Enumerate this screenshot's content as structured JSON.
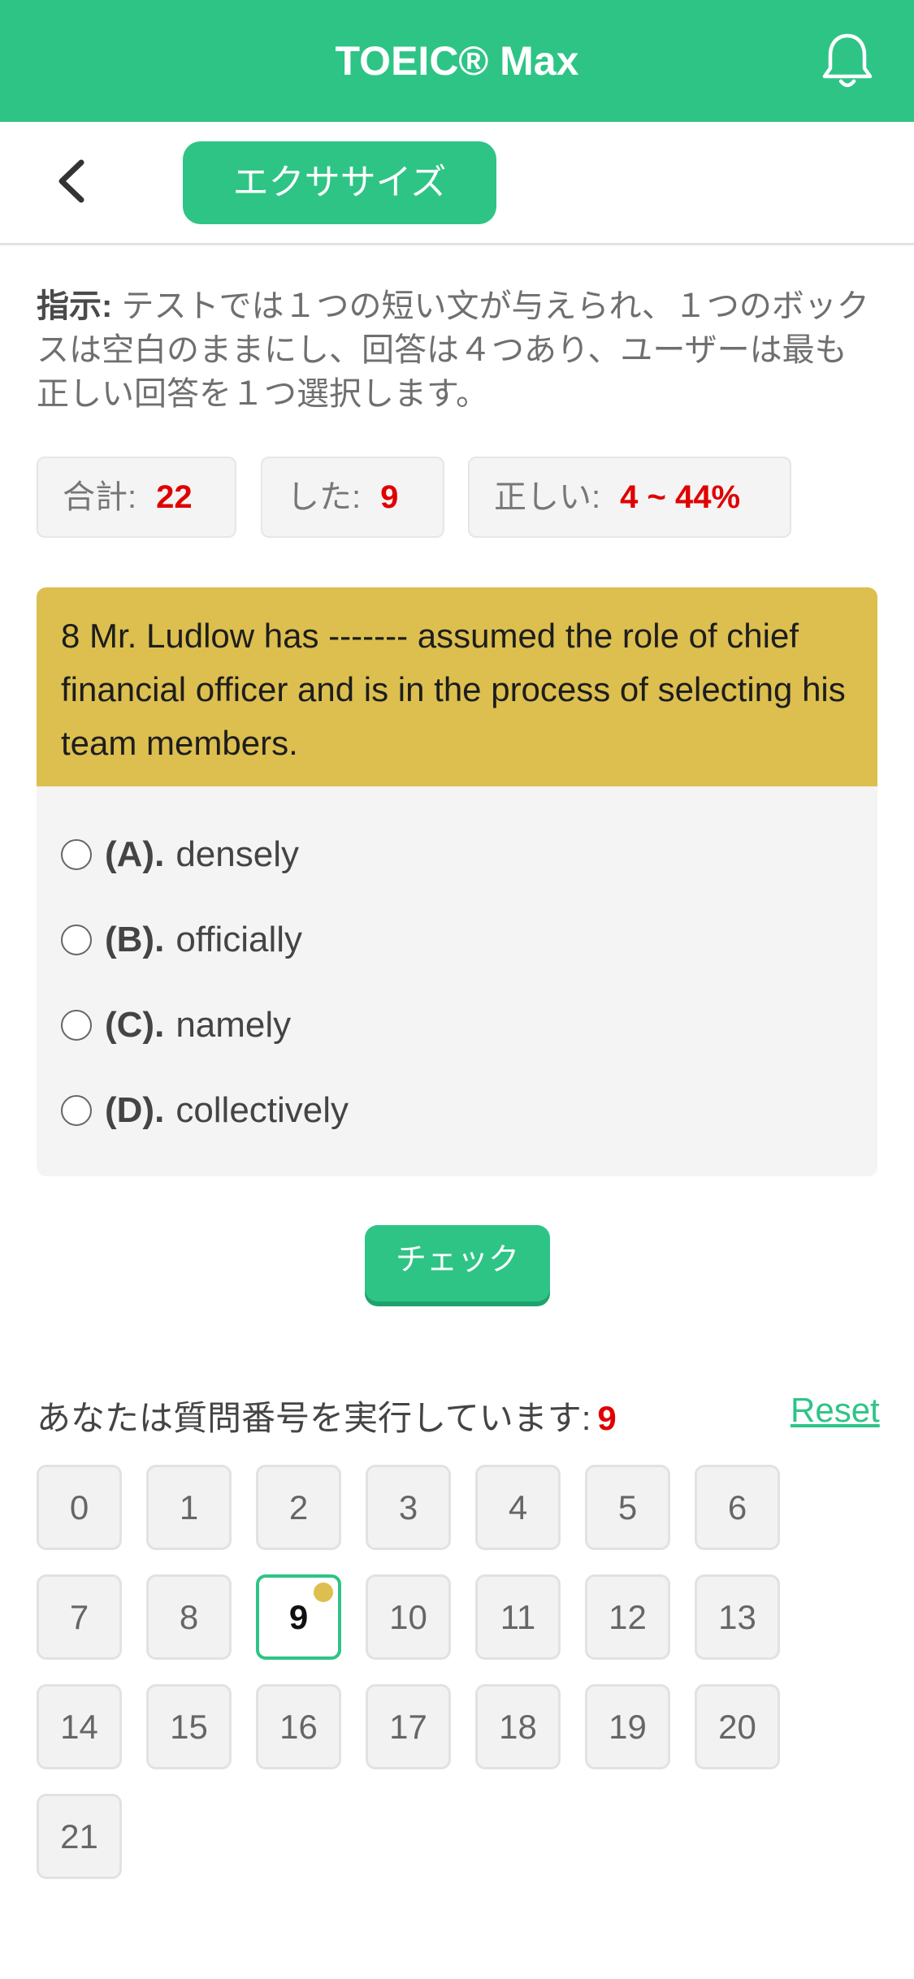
{
  "header": {
    "title": "TOEIC® Max",
    "bell_icon": "bell-icon"
  },
  "subnav": {
    "back_icon": "chevron-left-icon",
    "tab_label": "エクササイズ"
  },
  "instruction": {
    "label": "指示:",
    "text": " テストでは１つの短い文が与えられ、１つのボックスは空白のままにし、回答は４つあり、ユーザーは最も正しい回答を１つ選択します。"
  },
  "stats": {
    "total_label": "合計:",
    "total_value": "22",
    "done_label": "した:",
    "done_value": "9",
    "correct_label": "正しい:",
    "correct_value": "4 ~ 44%"
  },
  "question": {
    "text": "8 Mr. Ludlow has ------- assumed the role of chief financial officer and is in the process of selecting his team members.",
    "options": [
      {
        "letter": "(A).",
        "text": "densely"
      },
      {
        "letter": "(B).",
        "text": "officially"
      },
      {
        "letter": "(C).",
        "text": "namely"
      },
      {
        "letter": "(D).",
        "text": "collectively"
      }
    ]
  },
  "check_label": "チェック",
  "progress": {
    "label": "あなたは質問番号を実行しています:",
    "current": "9",
    "reset_label": "Reset"
  },
  "question_numbers": [
    "0",
    "1",
    "2",
    "3",
    "4",
    "5",
    "6",
    "7",
    "8",
    "9",
    "10",
    "11",
    "12",
    "13",
    "14",
    "15",
    "16",
    "17",
    "18",
    "19",
    "20",
    "21"
  ],
  "current_index": 9,
  "colors": {
    "brand_green": "#2ec486",
    "question_yellow": "#dcbf4f",
    "accent_red": "#e00000"
  }
}
